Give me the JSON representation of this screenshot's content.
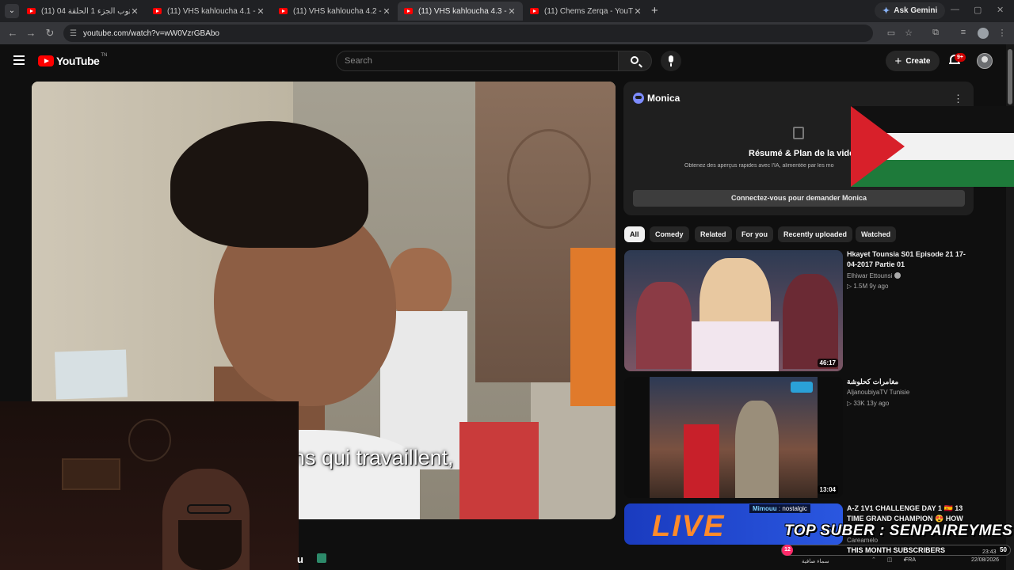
{
  "browser": {
    "tabs": [
      {
        "title": "(11) مكتوب الجزء 1 الحلقة 04 - ...e",
        "active": false
      },
      {
        "title": "(11) VHS kahloucha 4.1 - YouTube",
        "active": false
      },
      {
        "title": "(11) VHS kahloucha 4.2 - YouTube",
        "active": false
      },
      {
        "title": "(11) VHS kahloucha 4.3 - YouTube",
        "active": true
      },
      {
        "title": "(11) Chems Zerqa - YouTube",
        "active": false
      }
    ],
    "ask_gemini": "Ask Gemini",
    "url": "youtube.com/watch?v=wW0VzrGBAbo"
  },
  "youtube": {
    "logo_text": "YouTube",
    "logo_tm": "TN",
    "search_placeholder": "Search",
    "create_label": "Create",
    "notif_badge": "9+"
  },
  "player": {
    "subtitle": "ns qui travaillent,"
  },
  "monica": {
    "title": "Monica",
    "heading": "Résumé & Plan de la vidéo",
    "description": "Obtenez des aperçus rapides avec l'IA, alimentée par les mo",
    "connect_button": "Connectez-vous pour demander Monica"
  },
  "chips": [
    "All",
    "Comedy",
    "Related",
    "For you",
    "Recently uploaded",
    "Watched"
  ],
  "recommendations": [
    {
      "title": "Hkayet Tounsia S01 Episode 21 17-04-2017 Partie 01",
      "channel": "Elhiwar Ettounsi",
      "verified": true,
      "meta": "▷ 1.5M  9y ago",
      "duration": "46:17"
    },
    {
      "title": "مغامرات كحلوشة",
      "channel": "AljanoubiyaTV Tunisie",
      "verified": false,
      "meta": "▷ 33K  13y ago",
      "duration": "13:04"
    },
    {
      "title": "A-Z 1V1 CHALLENGE DAY 1 🇪🇸 13 TIME GRAND CHAMPION 😍 HOW",
      "channel": "Careamelo",
      "verified": false,
      "meta": "",
      "duration": ""
    }
  ],
  "overlay": {
    "chat_name": "Mimouu",
    "chat_text": ": nostalgic",
    "topsuber": "TOP SUBER : SENPAIREYMES",
    "subs_left": "12",
    "subs_label": "THIS MONTH SUBSCRIBERS",
    "subs_right": "50",
    "live_text": "LIVE",
    "tray_weather": "سماء صافية",
    "tray_lang": "FRA",
    "tray_time": "23:43",
    "tray_date": "22/08/2026"
  },
  "colors": {
    "accent_red": "#ff0000",
    "badge_red": "#cc0000",
    "background": "#0f0f0f",
    "chip_bg": "#272727"
  }
}
